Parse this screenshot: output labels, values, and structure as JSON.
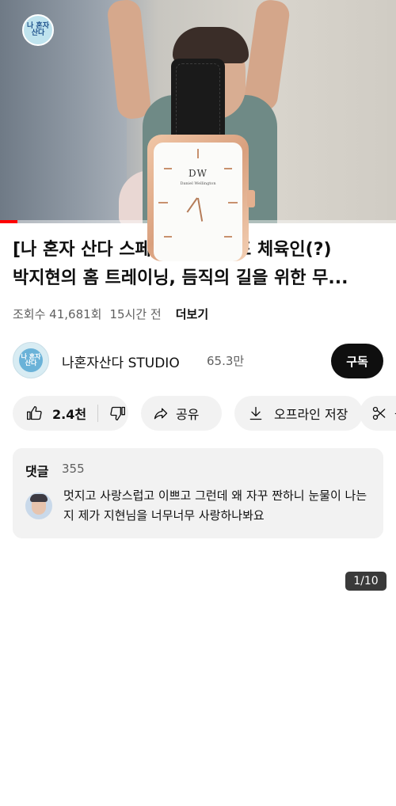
{
  "player": {
    "channel_logo_text": "나 혼자 산다",
    "progress_fraction": 0.044
  },
  "video": {
    "title_line1": "[나 혼자 산다 스페셜 클립] 목포 체육인(?)",
    "title_line2": "박지현의 홈 트레이닝, 듬직의 길을 위한 무...",
    "views": "조회수 41,681회",
    "age": "15시간 전",
    "more_label": "더보기"
  },
  "channel": {
    "name": "나혼자산다 STUDIO",
    "subscribers": "65.3만",
    "subscribe_label": "구독",
    "avatar_text": "나 혼자 산다"
  },
  "actions": {
    "like_count": "2.4천",
    "share_label": "공유",
    "download_label": "오프라인 저장",
    "clip_label": "클"
  },
  "comments": {
    "header": "댓글",
    "count": "355",
    "top_comment": "멋지고 사랑스럽고 이쁘고 그런데 왜 자꾸 짠하니 눈물이 나는지 제가 지현님을 너무너무 사랑하나봐요"
  },
  "ad": {
    "counter": "1/10",
    "dial_brand": "DW",
    "dial_sub": "Daniel Wellington"
  },
  "colors": {
    "accent": "#ff0000",
    "primary_text": "#0f0f0f",
    "secondary_text": "#606060",
    "pill_bg": "#f2f2f2"
  }
}
